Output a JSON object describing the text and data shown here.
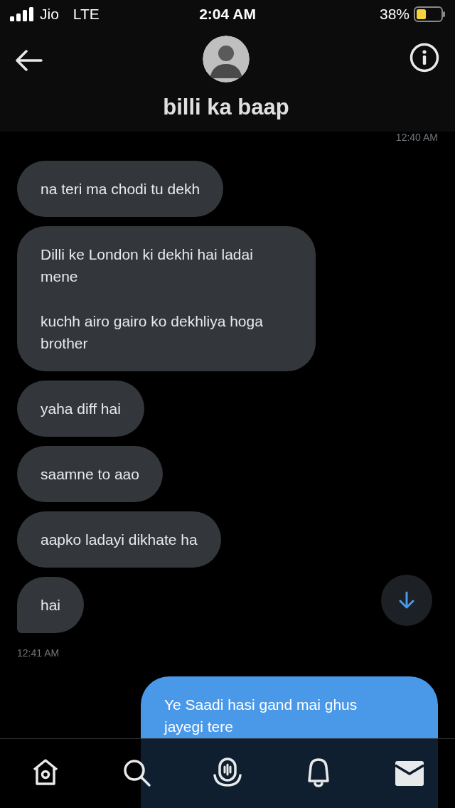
{
  "status_bar": {
    "carrier": "Jio",
    "network": "LTE",
    "time": "2:04 AM",
    "battery": "38%"
  },
  "header": {
    "title": "billi ka baap"
  },
  "messages": [
    {
      "kind": "time_sent",
      "text": "12:40 AM"
    },
    {
      "kind": "received",
      "paragraphs": [
        "na teri ma chodi tu dekh"
      ]
    },
    {
      "kind": "received",
      "paragraphs": [
        "Dilli ke London ki dekhi hai ladai mene",
        "kuchh airo gairo ko dekhliya hoga brother"
      ]
    },
    {
      "kind": "received",
      "paragraphs": [
        "yaha diff hai"
      ]
    },
    {
      "kind": "received",
      "paragraphs": [
        "saamne to aao"
      ]
    },
    {
      "kind": "received",
      "paragraphs": [
        "aapko ladayi dikhate ha"
      ]
    },
    {
      "kind": "received",
      "paragraphs": [
        "hai"
      ]
    },
    {
      "kind": "time_received",
      "text": "12:41 AM"
    },
    {
      "kind": "sent",
      "paragraphs": [
        "Ye Saadi hasi gand mai ghus jayegi tere"
      ]
    }
  ],
  "tab_bar": [
    {
      "kind": "home",
      "selected": false
    },
    {
      "kind": "search",
      "selected": false
    },
    {
      "kind": "spaces",
      "selected": false
    },
    {
      "kind": "notifications",
      "selected": false
    },
    {
      "kind": "messages",
      "selected": true
    }
  ]
}
